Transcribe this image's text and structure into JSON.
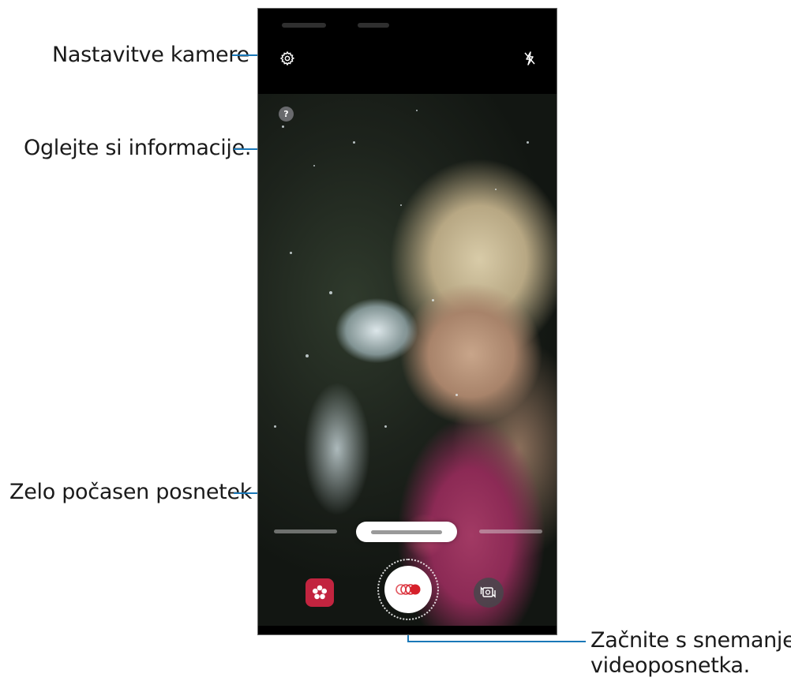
{
  "callouts": {
    "camera_settings": "Nastavitve kamere",
    "view_info": "Oglejte si informacije.",
    "super_slow_mo": "Zelo počasen posnetek",
    "start_recording_line1": "Začnite s snemanjem",
    "start_recording_line2": "videoposnetka."
  },
  "camera": {
    "help_label": "?",
    "icons": {
      "settings": "gear-icon",
      "flash": "flash-off-icon",
      "help": "help-icon",
      "effects": "flower-icon",
      "record": "super-slow-mo-record-icon",
      "switch": "switch-camera-icon"
    }
  },
  "colors": {
    "callout_line": "#1a78b8",
    "effect_button": "#c2243f",
    "record_dot": "#d6202a"
  }
}
